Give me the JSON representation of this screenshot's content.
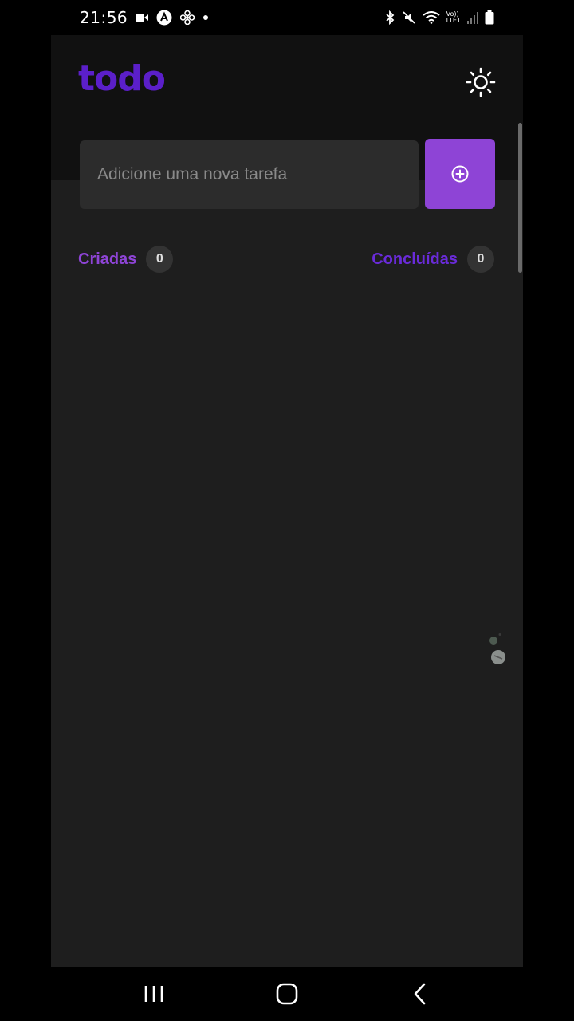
{
  "status_bar": {
    "time": "21:56",
    "lte_top": "Vo))",
    "lte_bottom": "LTE1",
    "icons": [
      "video-icon",
      "app-icon",
      "fan-icon",
      "dot-icon",
      "bluetooth-icon",
      "mute-icon",
      "wifi-icon",
      "signal-icon",
      "battery-icon"
    ]
  },
  "app": {
    "logo": "todo",
    "theme_icon": "sun-icon",
    "input_placeholder": "Adicione uma nova tarefa",
    "add_icon": "plus-circle-icon",
    "counters": {
      "created_label": "Criadas",
      "created_count": "0",
      "done_label": "Concluídas",
      "done_count": "0"
    }
  },
  "colors": {
    "accent": "#8e44d6",
    "logo": "#5b1fc9",
    "done_label": "#6a2bd9",
    "background": "#1e1e1e",
    "header": "#111111"
  },
  "nav_bar": {
    "icons": [
      "recent-apps-icon",
      "home-icon",
      "back-icon"
    ]
  }
}
